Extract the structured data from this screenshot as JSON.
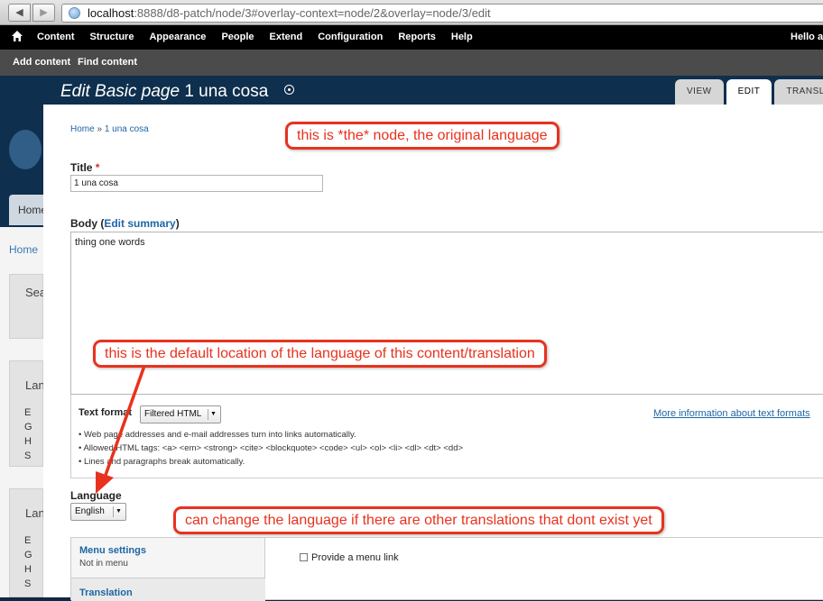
{
  "browser": {
    "url_host": "localhost",
    "url_rest": ":8888/d8-patch/node/3#overlay-context=node/2&overlay=node/3/edit"
  },
  "toolbar": {
    "items": [
      "Content",
      "Structure",
      "Appearance",
      "People",
      "Extend",
      "Configuration",
      "Reports",
      "Help"
    ],
    "hello": "Hello ac"
  },
  "shortcuts": {
    "add_content": "Add content",
    "find_content": "Find content"
  },
  "background": {
    "tab_label": "Home",
    "breadcrumb": "Home",
    "search_label": "Sea",
    "block1_title": "Lan",
    "block1_items": [
      "E",
      "G",
      "H",
      "S"
    ],
    "block2_title": "Lan",
    "block2_items": [
      "E",
      "G",
      "H",
      "S"
    ]
  },
  "overlay": {
    "title_prefix": "Edit Basic page",
    "title_node": "1 una cosa",
    "tabs": [
      "VIEW",
      "EDIT",
      "TRANSLA"
    ]
  },
  "form": {
    "breadcrumb_home": "Home",
    "breadcrumb_sep": "»",
    "breadcrumb_node": "1 una cosa",
    "title_label": "Title",
    "required_mark": "*",
    "title_value": "1 una cosa",
    "body_label": "Body",
    "edit_summary": "Edit summary",
    "body_value": "thing one words",
    "text_format_label": "Text format",
    "text_format_value": "Filtered HTML",
    "more_info": "More information about text formats",
    "tips": [
      "Web page addresses and e-mail addresses turn into links automatically.",
      "Allowed HTML tags: <a> <em> <strong> <cite> <blockquote> <code> <ul> <ol> <li> <dl> <dt> <dd>",
      "Lines and paragraphs break automatically."
    ],
    "language_label": "Language",
    "language_value": "English",
    "menu_settings": "Menu settings",
    "menu_settings_summary": "Not in menu",
    "translation_tab": "Translation",
    "menu_link_checkbox": "Provide a menu link"
  },
  "annotations": {
    "original": "this is *the* node, the original language",
    "default_location": "this is the default location of the language of this content/translation",
    "can_change": "can change the language if there are other translations that dont exist yet"
  },
  "colors": {
    "annotation": "#e8321e",
    "link": "#1d66a4",
    "toolbar": "#000000"
  }
}
